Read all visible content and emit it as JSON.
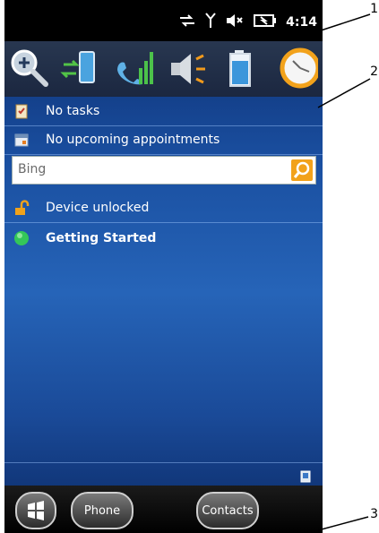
{
  "status_bar": {
    "time": "4:14",
    "icons": [
      "sync-icon",
      "signal-antenna-icon",
      "speaker-muted-icon",
      "battery-charging-icon"
    ]
  },
  "toolbar": {
    "tools": [
      "zoom-icon",
      "data-connection-icon",
      "signal-strength-icon",
      "volume-icon",
      "battery-icon",
      "clock-icon"
    ]
  },
  "rows": {
    "tasks": "No tasks",
    "appointments": "No upcoming appointments",
    "device": "Device unlocked",
    "getting_started": "Getting Started"
  },
  "search": {
    "placeholder": "Bing"
  },
  "bottom_bar": {
    "phone": "Phone",
    "contacts": "Contacts"
  },
  "callouts": [
    "1",
    "2",
    "3"
  ],
  "colors": {
    "search_button": "#f2a21b",
    "green_dot": "#34c759"
  }
}
